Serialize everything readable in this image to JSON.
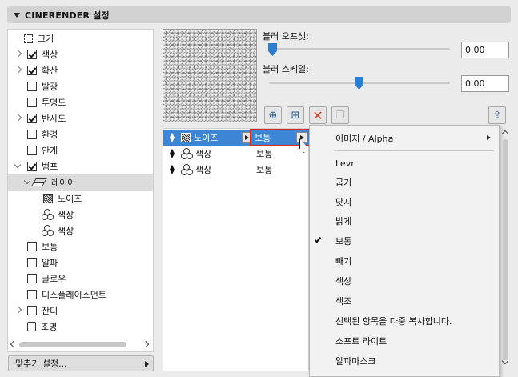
{
  "header": {
    "title": "CINERENDER 설정"
  },
  "tree": {
    "items": [
      {
        "label": "크기",
        "icon": "size-icon",
        "checked": null,
        "expander": "none"
      },
      {
        "label": "색상",
        "checked": true,
        "expander": "closed"
      },
      {
        "label": "확산",
        "checked": true,
        "expander": "closed"
      },
      {
        "label": "발광",
        "checked": false,
        "expander": "none"
      },
      {
        "label": "투명도",
        "checked": false,
        "expander": "none"
      },
      {
        "label": "반사도",
        "checked": true,
        "expander": "closed"
      },
      {
        "label": "환경",
        "checked": false,
        "expander": "none"
      },
      {
        "label": "안개",
        "checked": false,
        "expander": "none"
      },
      {
        "label": "범프",
        "checked": true,
        "expander": "open"
      },
      {
        "label": "레이어",
        "icon": "layer-icon",
        "expander": "open",
        "selected": true
      },
      {
        "label": "노이즈",
        "icon": "noise-icon"
      },
      {
        "label": "색상",
        "icon": "color-icon"
      },
      {
        "label": "색상",
        "icon": "color-icon"
      },
      {
        "label": "보통",
        "checked": false,
        "expander": "none"
      },
      {
        "label": "알파",
        "checked": false,
        "expander": "none"
      },
      {
        "label": "글로우",
        "checked": false,
        "expander": "none"
      },
      {
        "label": "디스플레이스먼트",
        "checked": false,
        "expander": "none"
      },
      {
        "label": "잔디",
        "checked": false,
        "expander": "closed"
      },
      {
        "label": "조명",
        "icon": "lamp-icon"
      }
    ],
    "fit_settings_label": "맞추기 설정..."
  },
  "controls": {
    "blur_offset_label": "블러 오프셋:",
    "blur_offset_value": "0.00",
    "blur_offset_level": 0.0,
    "blur_scale_label": "블러 스케일:",
    "blur_scale_value": "0.00",
    "blur_scale_level": 0.5
  },
  "layers": [
    {
      "name": "노이즈",
      "mode": "보통",
      "icon": "noise-icon",
      "selected": true
    },
    {
      "name": "색상",
      "mode": "보통",
      "icon": "color-icon"
    },
    {
      "name": "색상",
      "mode": "보통",
      "icon": "color-icon"
    }
  ],
  "menu": {
    "items": [
      {
        "label": "이미지 / Alpha",
        "submenu": true
      },
      {
        "label": "Levr"
      },
      {
        "label": "굽기"
      },
      {
        "label": "닷지"
      },
      {
        "label": "밝게"
      },
      {
        "label": "보통",
        "checked": true
      },
      {
        "label": "빼기"
      },
      {
        "label": "색상"
      },
      {
        "label": "색조"
      },
      {
        "label": "선택된 항목을 다중 복사합니다."
      },
      {
        "label": "소프트 라이트"
      },
      {
        "label": "알파마스크"
      }
    ]
  },
  "colors": {
    "accent": "#3d86d6",
    "highlight_border": "#e0281a",
    "delete_icon": "#d63a1e"
  }
}
